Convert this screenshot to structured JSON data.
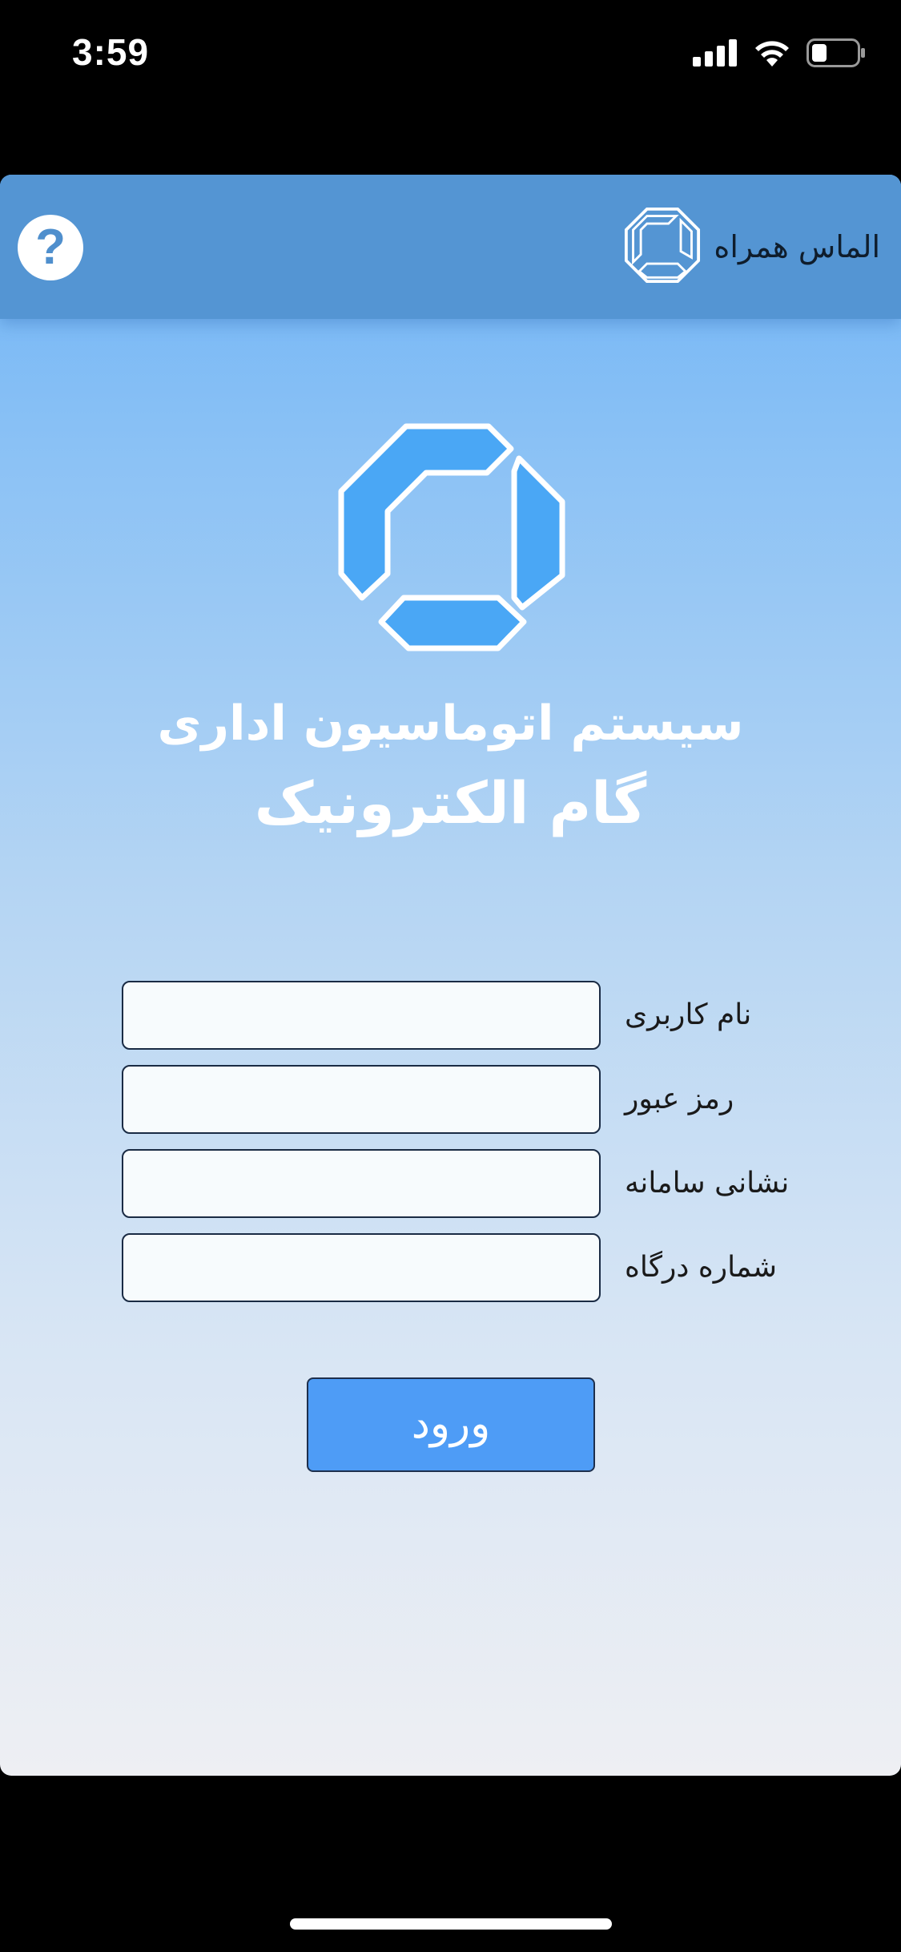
{
  "status_bar": {
    "time": "3:59"
  },
  "header": {
    "app_title": "الماس همراه",
    "help_label": "?"
  },
  "logo": {
    "icon": "gam-logo-icon",
    "slogan_line1": "سیستم اتوماسیون اداری",
    "slogan_line2": "گام الکترونیک"
  },
  "form": {
    "fields": [
      {
        "label": "نام کاربری",
        "value": "",
        "placeholder": ""
      },
      {
        "label": "رمز عبور",
        "value": "",
        "placeholder": ""
      },
      {
        "label": "نشانی سامانه",
        "value": "",
        "placeholder": ""
      },
      {
        "label": "شماره درگاه",
        "value": "",
        "placeholder": ""
      }
    ],
    "submit_label": "ورود"
  },
  "colors": {
    "header_bg": "#5495d3",
    "button_bg": "#4e9cf6",
    "gradient_top": "#6db3f6",
    "gradient_bottom": "#eeeff3"
  }
}
